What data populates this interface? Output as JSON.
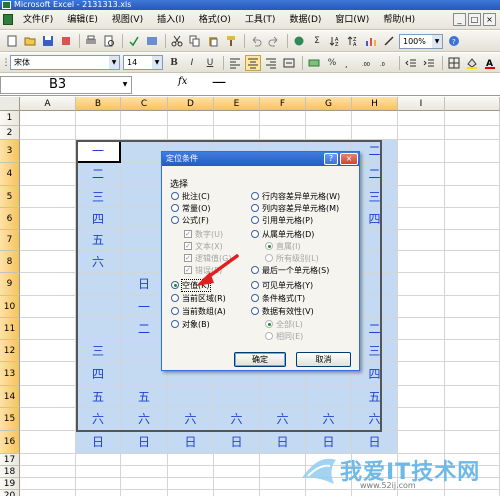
{
  "window": {
    "title": "Microsoft Excel - 2131313.xls"
  },
  "menu": {
    "items": [
      "文件(F)",
      "编辑(E)",
      "视图(V)",
      "插入(I)",
      "格式(O)",
      "工具(T)",
      "数据(D)",
      "窗口(W)",
      "帮助(H)"
    ],
    "window_buttons": [
      "_",
      "□",
      "×"
    ]
  },
  "toolbar": {
    "zoom": "100%",
    "font": "宋体",
    "font_size": "14",
    "bold": "B",
    "italic": "I",
    "underline": "U",
    "sum": "Σ",
    "percent": "%"
  },
  "formula_bar": {
    "name_box": "B3",
    "fx": "fx",
    "content": "一"
  },
  "grid": {
    "columns": [
      "A",
      "B",
      "C",
      "D",
      "E",
      "F",
      "G",
      "H",
      "I"
    ],
    "rows": [
      "1",
      "2",
      "3",
      "4",
      "5",
      "6",
      "7",
      "8",
      "9",
      "10",
      "11",
      "12",
      "13",
      "14",
      "15",
      "16",
      "17",
      "18",
      "19",
      "20"
    ],
    "visible_cells": [
      {
        "ref": "B3",
        "text": "一"
      },
      {
        "ref": "H3",
        "text": "二"
      },
      {
        "ref": "B4",
        "text": "二"
      },
      {
        "ref": "H4",
        "text": "二"
      },
      {
        "ref": "B5",
        "text": "三"
      },
      {
        "ref": "H5",
        "text": "三"
      },
      {
        "ref": "B6",
        "text": "四"
      },
      {
        "ref": "H6",
        "text": "四"
      },
      {
        "ref": "B7",
        "text": "五"
      },
      {
        "ref": "B8",
        "text": "六"
      },
      {
        "ref": "C9",
        "text": "日"
      },
      {
        "ref": "C10",
        "text": "一"
      },
      {
        "ref": "C11",
        "text": "二"
      },
      {
        "ref": "H11",
        "text": "二"
      },
      {
        "ref": "B12",
        "text": "三"
      },
      {
        "ref": "H12",
        "text": "三"
      },
      {
        "ref": "B13",
        "text": "四"
      },
      {
        "ref": "H13",
        "text": "四"
      },
      {
        "ref": "B14",
        "text": "五"
      },
      {
        "ref": "C14",
        "text": "五"
      },
      {
        "ref": "H14",
        "text": "五"
      },
      {
        "ref": "B15",
        "text": "六"
      },
      {
        "ref": "C15",
        "text": "六"
      },
      {
        "ref": "D15",
        "text": "六"
      },
      {
        "ref": "E15",
        "text": "六"
      },
      {
        "ref": "F15",
        "text": "六"
      },
      {
        "ref": "G15",
        "text": "六"
      },
      {
        "ref": "H15",
        "text": "六"
      },
      {
        "ref": "B16",
        "text": "日"
      },
      {
        "ref": "C16",
        "text": "日"
      },
      {
        "ref": "D16",
        "text": "日"
      },
      {
        "ref": "E16",
        "text": "日"
      },
      {
        "ref": "F16",
        "text": "日"
      },
      {
        "ref": "G16",
        "text": "日"
      },
      {
        "ref": "H16",
        "text": "日"
      }
    ]
  },
  "dialog": {
    "title": "定位条件",
    "help": "?",
    "close": "×",
    "group_label": "选择",
    "left_options": [
      {
        "label": "批注(C)",
        "type": "radio",
        "checked": false,
        "disabled": false
      },
      {
        "label": "常量(O)",
        "type": "radio",
        "checked": false,
        "disabled": false
      },
      {
        "label": "公式(F)",
        "type": "radio",
        "checked": false,
        "disabled": false
      },
      {
        "label": "数字(U)",
        "type": "check",
        "checked": true,
        "disabled": true
      },
      {
        "label": "文本(X)",
        "type": "check",
        "checked": true,
        "disabled": true
      },
      {
        "label": "逻辑值(G)",
        "type": "check",
        "checked": true,
        "disabled": true
      },
      {
        "label": "错误(E)",
        "type": "check",
        "checked": true,
        "disabled": true
      },
      {
        "label": "空值(K)",
        "type": "radio",
        "checked": true,
        "disabled": false
      },
      {
        "label": "当前区域(R)",
        "type": "radio",
        "checked": false,
        "disabled": false
      },
      {
        "label": "当前数组(A)",
        "type": "radio",
        "checked": false,
        "disabled": false
      },
      {
        "label": "对象(B)",
        "type": "radio",
        "checked": false,
        "disabled": false
      }
    ],
    "right_options": [
      {
        "label": "行内容差异单元格(W)",
        "type": "radio",
        "checked": false,
        "disabled": false
      },
      {
        "label": "列内容差异单元格(M)",
        "type": "radio",
        "checked": false,
        "disabled": false
      },
      {
        "label": "引用单元格(P)",
        "type": "radio",
        "checked": false,
        "disabled": false
      },
      {
        "label": "从属单元格(D)",
        "type": "radio",
        "checked": false,
        "disabled": false
      },
      {
        "label": "直属(I)",
        "type": "radio",
        "checked": true,
        "disabled": true
      },
      {
        "label": "所有级别(L)",
        "type": "radio",
        "checked": false,
        "disabled": true
      },
      {
        "label": "最后一个单元格(S)",
        "type": "radio",
        "checked": false,
        "disabled": false
      },
      {
        "label": "可见单元格(Y)",
        "type": "radio",
        "checked": false,
        "disabled": false
      },
      {
        "label": "条件格式(T)",
        "type": "radio",
        "checked": false,
        "disabled": false
      },
      {
        "label": "数据有效性(V)",
        "type": "radio",
        "checked": false,
        "disabled": false
      },
      {
        "label": "全部(L)",
        "type": "radio",
        "checked": true,
        "disabled": true
      },
      {
        "label": "相同(E)",
        "type": "radio",
        "checked": false,
        "disabled": true
      }
    ],
    "ok_label": "确定",
    "cancel_label": "取消"
  },
  "watermark": {
    "text": "我爱IT技术网",
    "url": "www.52ij.com"
  },
  "colors": {
    "selection": "#c4daf3",
    "cell_text": "#1f3fd1",
    "title_bar": "#2f6fd6"
  }
}
